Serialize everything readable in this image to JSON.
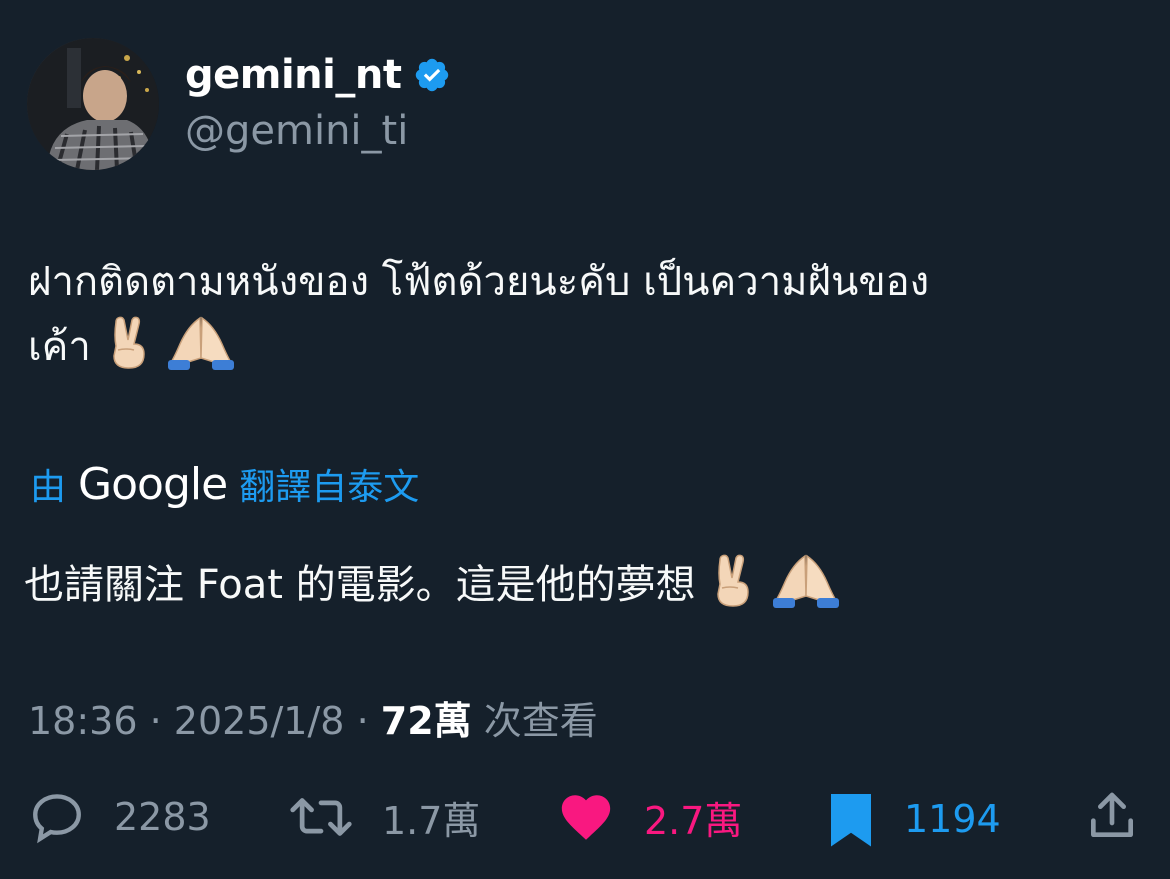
{
  "author": {
    "display_name": "gemini_nt",
    "handle": "@gemini_ti",
    "verified_icon": "verified-badge-icon"
  },
  "tweet": {
    "text_line1": "ฝากติดตามหนังของ โฟ้ตด้วยนะคับ เป็นความฝันของ",
    "text_line2": "เค้า",
    "emojis": [
      "victory-hand-icon",
      "folded-hands-icon"
    ]
  },
  "translation": {
    "prefix": "由",
    "provider": "Google",
    "suffix": "翻譯自泰文",
    "translated_text": "也請關注 Foat 的電影。這是他的夢想"
  },
  "meta": {
    "time": "18:36",
    "separator": "·",
    "date": "2025/1/8",
    "views_count": "72萬",
    "views_label": "次查看"
  },
  "actions": {
    "reply_count": "2283",
    "retweet_count": "1.7萬",
    "like_count": "2.7萬",
    "bookmark_count": "1194"
  },
  "colors": {
    "background": "#15202b",
    "accent_blue": "#1d9bf0",
    "like_pink": "#f91880",
    "muted": "#8b98a5"
  }
}
